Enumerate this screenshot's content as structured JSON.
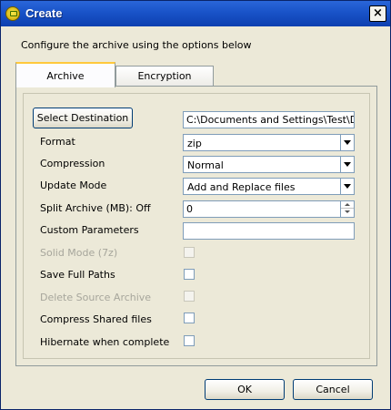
{
  "window": {
    "title": "Create",
    "close_glyph": "×"
  },
  "intro_text": "Configure the archive using the options below",
  "tabs": [
    {
      "label": "Archive",
      "active": true
    },
    {
      "label": "Encryption",
      "active": false
    }
  ],
  "archive": {
    "select_destination_label": "Select Destination",
    "destination_value": "C:\\Documents and Settings\\Test\\De",
    "format": {
      "label": "Format",
      "value": "zip"
    },
    "compression": {
      "label": "Compression",
      "value": "Normal"
    },
    "update_mode": {
      "label": "Update Mode",
      "value": "Add and Replace files"
    },
    "split_archive": {
      "label": "Split Archive (MB): Off",
      "value": "0"
    },
    "custom_parameters": {
      "label": "Custom Parameters",
      "value": ""
    },
    "solid_mode": {
      "label": "Solid Mode (7z)",
      "checked": false,
      "disabled": true
    },
    "save_full_paths": {
      "label": "Save Full Paths",
      "checked": false,
      "disabled": false
    },
    "delete_source": {
      "label": "Delete Source Archive",
      "checked": false,
      "disabled": true
    },
    "compress_shared": {
      "label": "Compress Shared files",
      "checked": false,
      "disabled": false
    },
    "hibernate": {
      "label": "Hibernate when complete",
      "checked": false,
      "disabled": false
    }
  },
  "footer": {
    "ok_label": "OK",
    "cancel_label": "Cancel"
  },
  "colors": {
    "titlebar": "#1953c8",
    "dialog_bg": "#ece9d8",
    "tab_highlight": "#ffc83c"
  }
}
